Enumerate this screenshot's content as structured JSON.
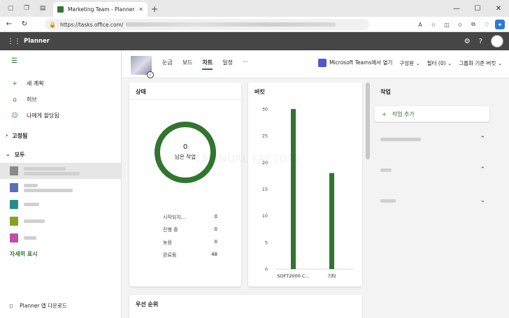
{
  "browser": {
    "tab_title": "Marketing Team - Planner",
    "url_prefix": "https://tasks.office.com/",
    "close_glyph": "✕",
    "new_tab_glyph": "+",
    "window_controls": [
      "—",
      "☐",
      "✕"
    ]
  },
  "app": {
    "name": "Planner"
  },
  "leftnav": {
    "new_plan": "새 계획",
    "hub": "허브",
    "assigned_to_me": "나에게 할당됨",
    "pinned_label": "고정됨",
    "all_label": "모두",
    "plans": [
      {
        "thumb_color": "#8a8a8a",
        "selected": true
      },
      {
        "thumb_color": "#5b6fb5",
        "selected": false
      },
      {
        "thumb_color": "#2a8a8a",
        "selected": false
      },
      {
        "thumb_color": "#8aa020",
        "selected": false
      },
      {
        "thumb_color": "#c050a0",
        "selected": false
      }
    ],
    "show_more": "자세히 표시",
    "download_app": "Planner 앱 다운로드"
  },
  "plan_header": {
    "tabs": [
      "눈금",
      "보드",
      "차트",
      "일정"
    ],
    "active_tab": "차트",
    "more": "···",
    "open_in_teams": "Microsoft Teams에서 열기",
    "members": "구성원",
    "filter": "필터 (0)",
    "group_by": "그룹화 기준 버킷"
  },
  "status_card": {
    "title": "상태",
    "remaining_count": "0",
    "remaining_label": "남은 작업",
    "stats": [
      {
        "label": "시작되지...",
        "value": "0"
      },
      {
        "label": "진행 중",
        "value": "0"
      },
      {
        "label": "늦음",
        "value": "0"
      },
      {
        "label": "완료됨",
        "value": "48"
      }
    ],
    "ring_color": "#31752f"
  },
  "bucket_card": {
    "title": "버킷"
  },
  "chart_data": {
    "type": "bar",
    "categories": [
      "SOFT2000.C...",
      "기타"
    ],
    "values": [
      30,
      18
    ],
    "ylim": [
      0,
      30
    ],
    "yticks": [
      0,
      5,
      10,
      15,
      20,
      25,
      30
    ],
    "bar_color": "#31752f"
  },
  "priority_card": {
    "title": "우선 순위"
  },
  "tasks_pane": {
    "title": "작업",
    "add_task": "작업 추가",
    "groups": [
      {
        "chevron": "⌃"
      },
      {
        "chevron": "⌃"
      },
      {
        "chevron": "⌄"
      }
    ]
  },
  "watermark": "MANUAL FACTORY"
}
